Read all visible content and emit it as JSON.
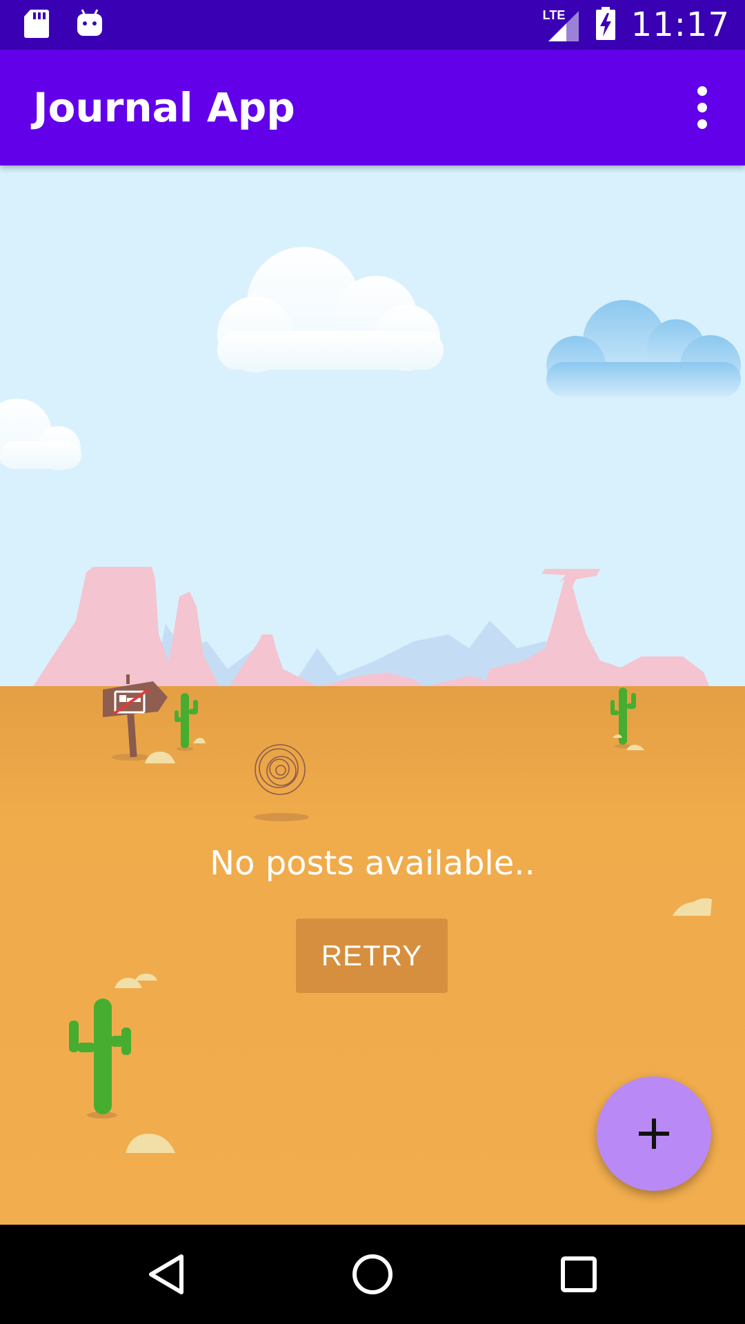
{
  "status_bar": {
    "time": "11:17",
    "network_label": "LTE",
    "icons": [
      "sd-card-icon",
      "android-icon",
      "signal-icon",
      "battery-charging-icon"
    ]
  },
  "app_bar": {
    "title": "Journal App",
    "menu_icon": "more-vert-icon"
  },
  "empty_state": {
    "message": "No posts available..",
    "retry_label": "RETRY"
  },
  "fab": {
    "icon": "plus-icon"
  },
  "nav_bar": {
    "icons": [
      "back-icon",
      "home-icon",
      "recents-icon"
    ]
  },
  "colors": {
    "status_bar": "#3a00b4",
    "app_bar": "#6200ea",
    "sky": "#d9f1fc",
    "sand": "#f0ab4b",
    "retry_button": "#d68f3e",
    "fab": "#b98af5"
  }
}
